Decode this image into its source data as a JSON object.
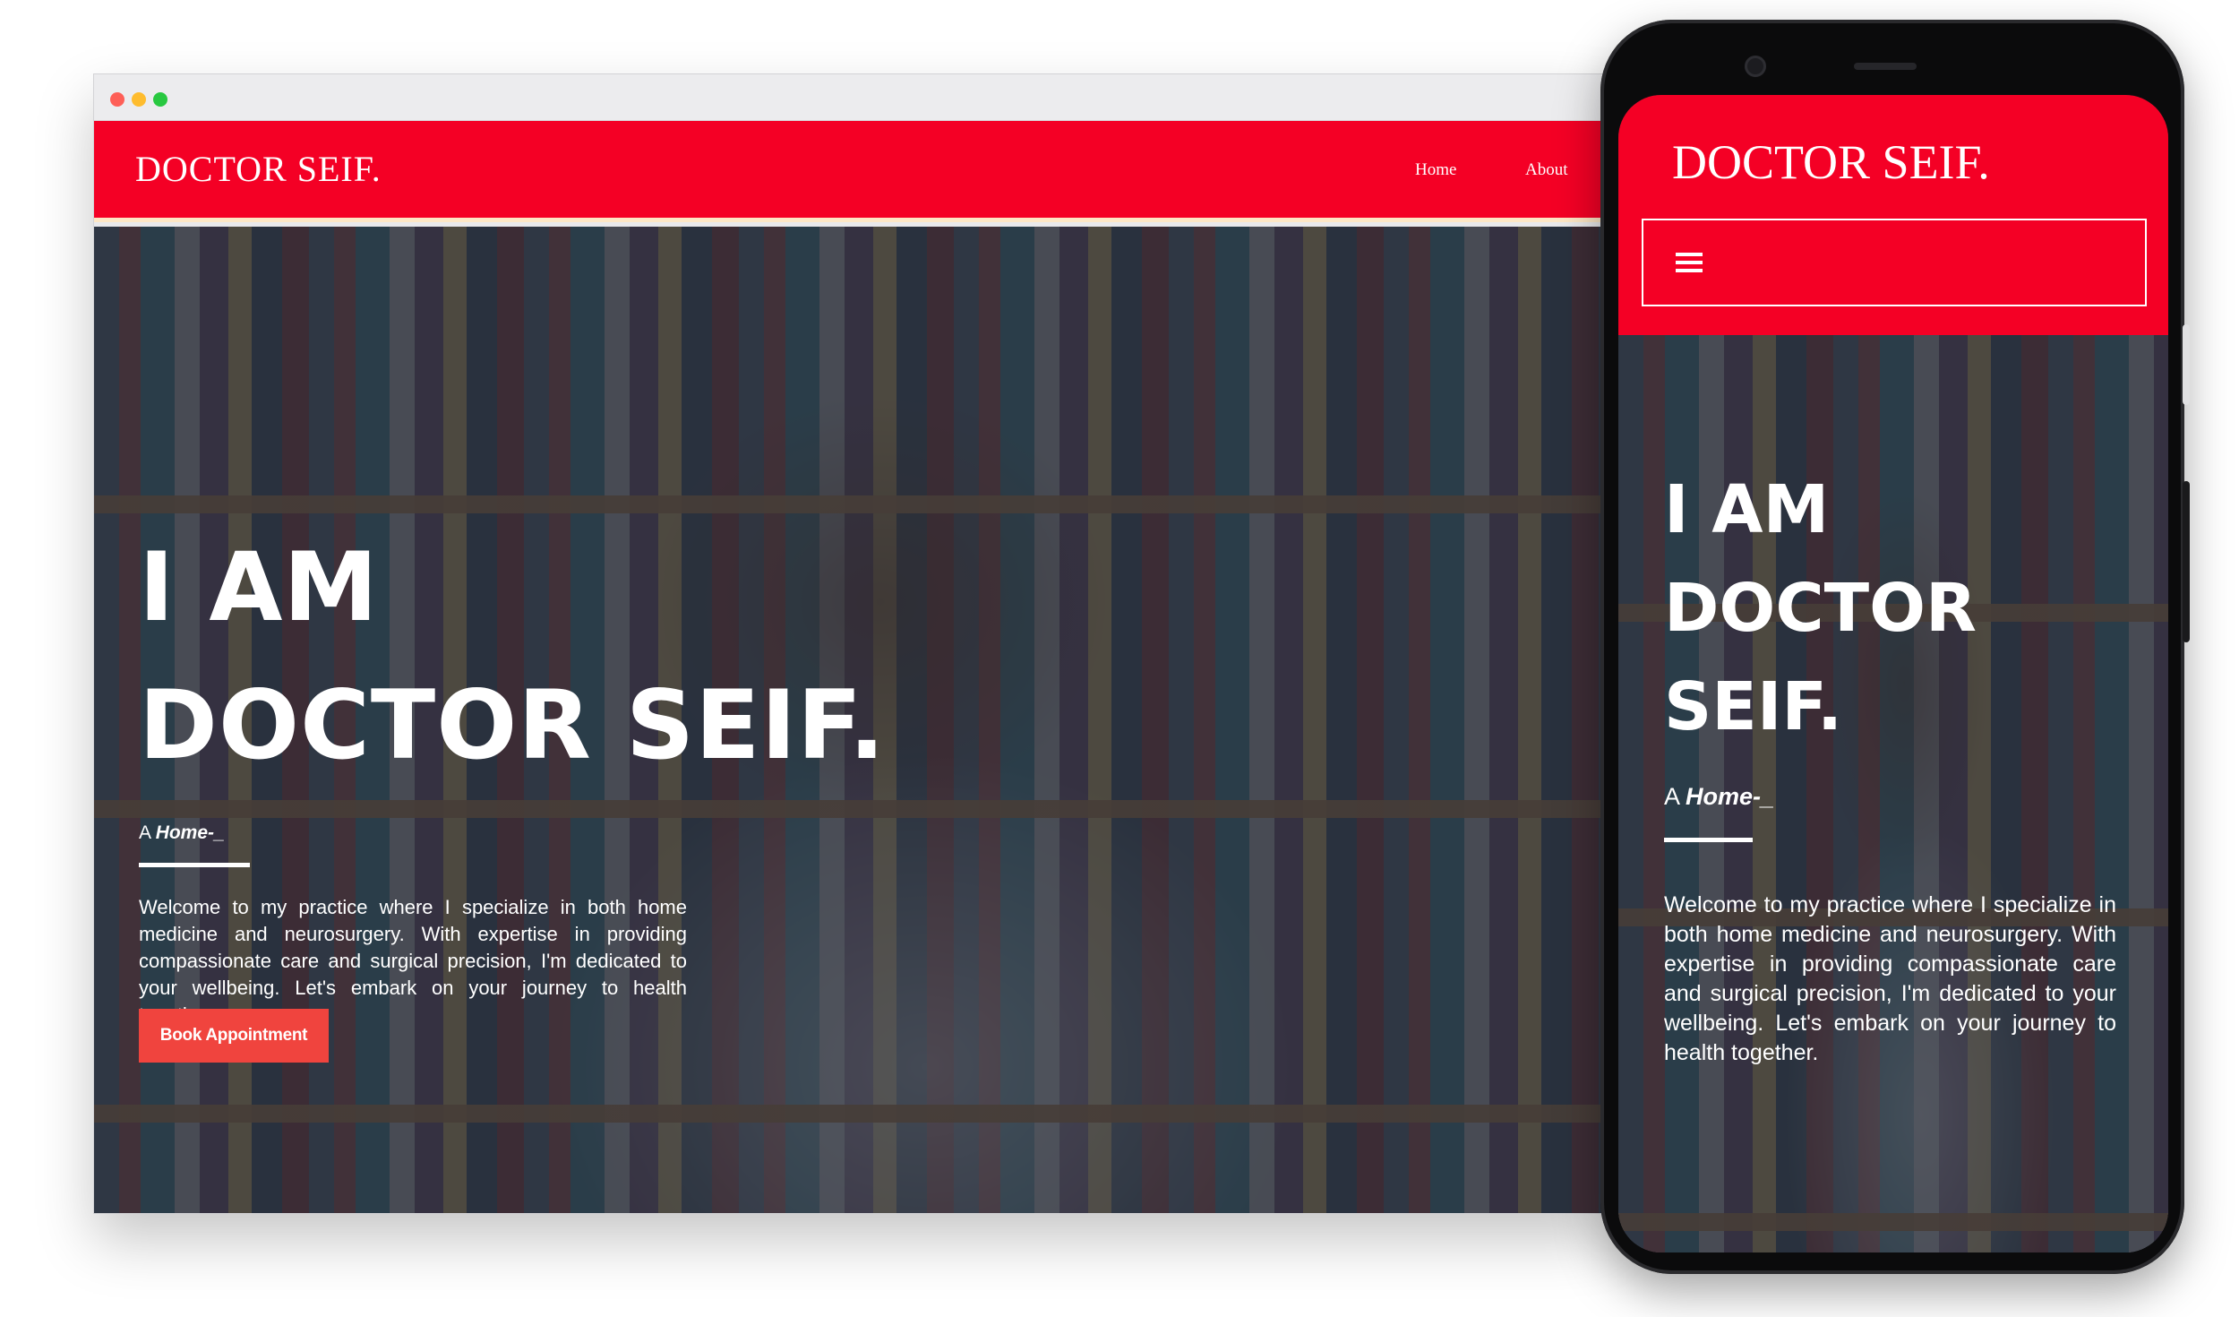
{
  "brand": "DOCTOR SEIF.",
  "nav": {
    "home": "Home",
    "about": "About"
  },
  "hero": {
    "heading_line1": "I AM",
    "heading_line2": "DOCTOR SEIF.",
    "sub_prefix": "A ",
    "sub_highlight": "Home-_",
    "description": "Welcome to my practice where I specialize in both home medicine and neurosurgery. With expertise in providing compassionate care and surgical precision, I'm dedicated to your wellbeing. Let's embark on your journey to health together.",
    "button_label": "Book Appointment"
  },
  "mobile": {
    "heading_line1": "I AM",
    "heading_line2": "DOCTOR",
    "heading_line3": "SEIF.",
    "menu_icon": "hamburger-menu-icon"
  },
  "colors": {
    "brand_red": "#f40025",
    "button_red": "#f0443e",
    "nav_underline": "#fde7c6"
  }
}
